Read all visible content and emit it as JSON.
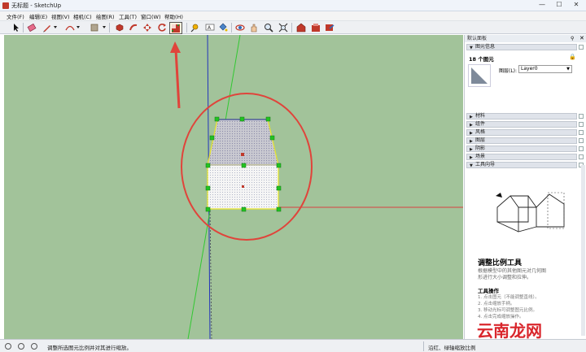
{
  "window": {
    "title": "无标题 - SketchUp",
    "buttons": [
      "—",
      "☐",
      "✕"
    ]
  },
  "menu": [
    "文件(F)",
    "编辑(E)",
    "视图(V)",
    "相机(C)",
    "绘图(R)",
    "工具(T)",
    "窗口(W)",
    "帮助(H)"
  ],
  "toolbar": {
    "icons": [
      "select-icon",
      "eraser-icon",
      "pencil-icon",
      "arc-icon",
      "shape-icon",
      "push-pull-icon",
      "follow-me-icon",
      "move-icon",
      "rotate-icon",
      "scale-icon",
      "tape-measure-icon",
      "text-icon",
      "paint-bucket-icon",
      "orbit-icon",
      "pan-icon",
      "zoom-icon",
      "zoom-extents-icon",
      "warehouse-icon",
      "extension-warehouse-icon",
      "share-icon"
    ]
  },
  "tray": {
    "title": "默认面板",
    "entity_info": {
      "header": "图元信息",
      "count": "18 个图元",
      "layer_label": "图层(L):",
      "layer_value": "Layer0"
    },
    "panels": [
      "材料",
      "组件",
      "风格",
      "图层",
      "阴影",
      "场景",
      "工具向导"
    ],
    "guide": {
      "title": "调整比例工具",
      "desc_line1": "根据模型中的其他图元对几何图",
      "desc_line2": "形进行大小调整和拉伸。",
      "ops_title": "工具操作",
      "ops": [
        "1.  点击图元（不能调整直线）。",
        "2.  点击缩放手柄。",
        "3.  移动光标可调整图元比例。",
        "4.  点击完成缩放操作。"
      ]
    }
  },
  "status": {
    "left": "调整所选图元比例并对其进行缩放。",
    "right": "沿红、绿轴缩放比例",
    "watermark": "云南龙网"
  },
  "colors": {
    "viewport_bg": "#a2c39a",
    "annotation_red": "#e0443b",
    "grip_green": "#22c322",
    "highlight_yellow": "#e8e42a"
  }
}
